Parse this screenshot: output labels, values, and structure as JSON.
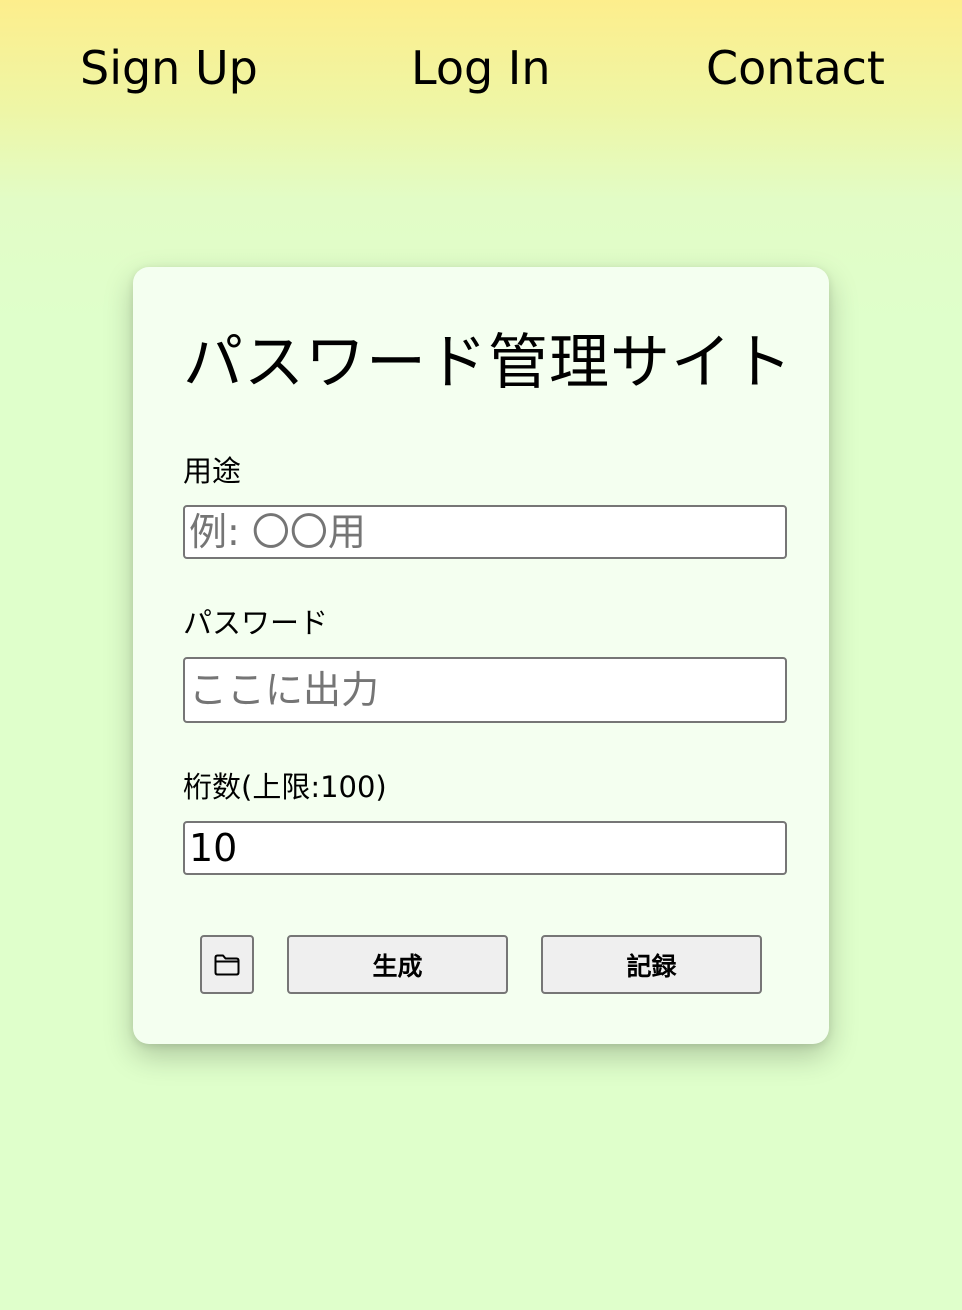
{
  "nav": {
    "items": [
      {
        "label": "Sign Up"
      },
      {
        "label": "Log In"
      },
      {
        "label": "Contact"
      }
    ]
  },
  "card": {
    "title": "パスワード管理サイト",
    "fields": {
      "usage": {
        "label": "用途",
        "value": "",
        "placeholder": "例: 〇〇用"
      },
      "password": {
        "label": "パスワード",
        "value": "",
        "placeholder": "ここに出力"
      },
      "length": {
        "label": "桁数(上限:100)",
        "value": "10",
        "placeholder": ""
      }
    },
    "buttons": {
      "folder_icon": "folder-icon",
      "generate_label": "生成",
      "record_label": "記録"
    }
  },
  "colors": {
    "background_top": "#fdee8c",
    "background": "#dfffcb",
    "card": "#f4fff0",
    "button": "#efefef",
    "border": "#767676"
  }
}
